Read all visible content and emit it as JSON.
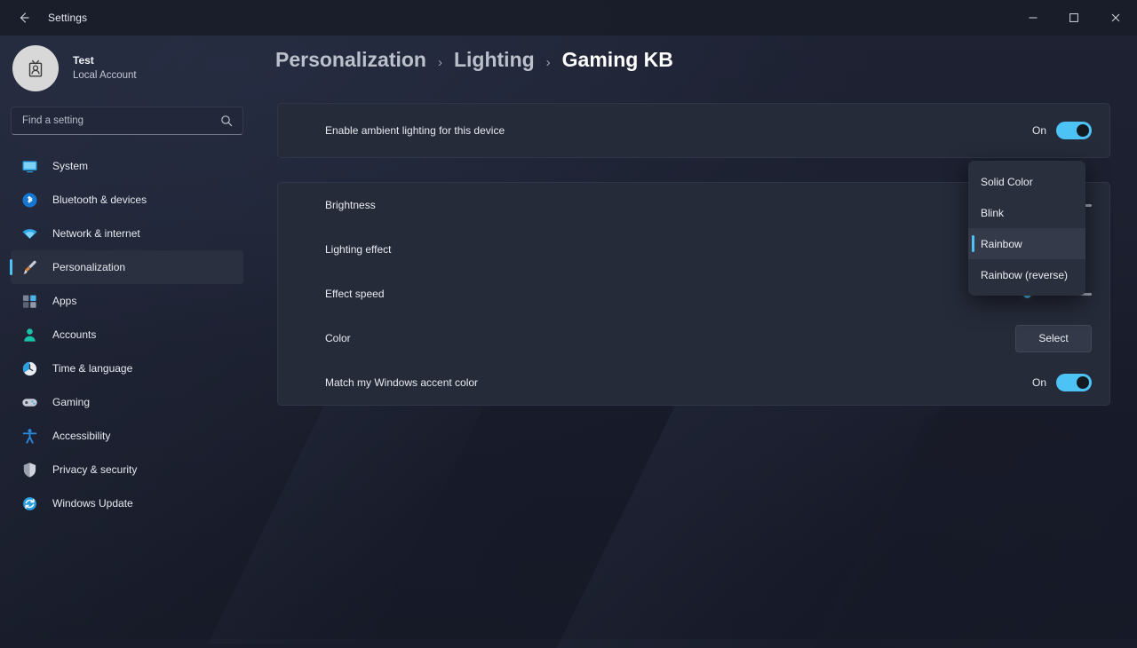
{
  "window": {
    "title": "Settings",
    "back_icon": "back-arrow-icon",
    "minimize_label": "─",
    "maximize_label": "☐",
    "close_label": "✕"
  },
  "account": {
    "name": "Test",
    "type": "Local Account",
    "avatar_icon": "user-badge-icon"
  },
  "search": {
    "placeholder": "Find a setting",
    "icon": "search-icon"
  },
  "sidebar": {
    "items": [
      {
        "label": "System",
        "icon": "display-icon",
        "selected": false
      },
      {
        "label": "Bluetooth & devices",
        "icon": "bluetooth-icon",
        "selected": false
      },
      {
        "label": "Network & internet",
        "icon": "wifi-icon",
        "selected": false
      },
      {
        "label": "Personalization",
        "icon": "paintbrush-icon",
        "selected": true
      },
      {
        "label": "Apps",
        "icon": "apps-icon",
        "selected": false
      },
      {
        "label": "Accounts",
        "icon": "person-icon",
        "selected": false
      },
      {
        "label": "Time & language",
        "icon": "clock-icon",
        "selected": false
      },
      {
        "label": "Gaming",
        "icon": "gamepad-icon",
        "selected": false
      },
      {
        "label": "Accessibility",
        "icon": "accessibility-icon",
        "selected": false
      },
      {
        "label": "Privacy & security",
        "icon": "shield-icon",
        "selected": false
      },
      {
        "label": "Windows Update",
        "icon": "update-icon",
        "selected": false
      }
    ]
  },
  "breadcrumb": {
    "items": [
      "Personalization",
      "Lighting",
      "Gaming KB"
    ],
    "separator": "›"
  },
  "enable_card": {
    "label": "Enable ambient lighting for this device",
    "toggle_state": "On",
    "toggle_on": true
  },
  "options_card": {
    "brightness": {
      "label": "Brightness",
      "value_percent": 75
    },
    "lighting_effect": {
      "label": "Lighting effect",
      "selected_value": "Rainbow"
    },
    "effect_speed": {
      "label": "Effect speed",
      "value_percent": 45
    },
    "color": {
      "label": "Color",
      "button_label": "Select"
    },
    "accent_match": {
      "label": "Match my Windows accent color",
      "toggle_state": "On",
      "toggle_on": true
    }
  },
  "dropdown": {
    "options": [
      {
        "label": "Solid Color",
        "selected": false
      },
      {
        "label": "Blink",
        "selected": false
      },
      {
        "label": "Rainbow",
        "selected": true
      },
      {
        "label": "Rainbow (reverse)",
        "selected": false
      }
    ]
  },
  "colors": {
    "accent": "#4cc2f5",
    "card_bg": "#262b3a",
    "page_bg": "#191d2b",
    "text_primary": "#e8e9ec"
  }
}
